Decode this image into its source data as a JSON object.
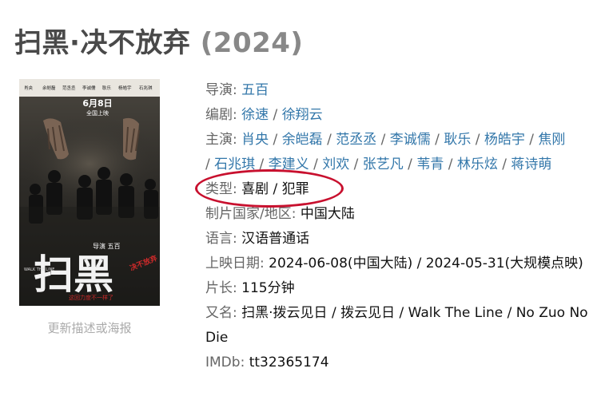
{
  "movie": {
    "title": "扫黑·决不放弃",
    "year": "(2024)"
  },
  "poster": {
    "credits": [
      "肖央",
      "余皑磊",
      "范丞丞",
      "李诚儒",
      "耿乐",
      "杨皓宇",
      "石兆琪"
    ],
    "date_line1": "6月8日",
    "date_line2": "全国上映",
    "director_line": "导演 五百",
    "title_chars": "扫黑",
    "sub_title": "决不放弃",
    "english": "WALK THE LINE",
    "tagline": "这回力度不一样了"
  },
  "update_link": "更新描述或海报",
  "info": {
    "director_label": "导演: ",
    "director": "五百",
    "writer_label": "编剧: ",
    "writers": [
      "徐速",
      "徐翔云"
    ],
    "cast_label": "主演: ",
    "cast": [
      "肖央",
      "余皑磊",
      "范丞丞",
      "李诚儒",
      "耿乐",
      "杨皓宇",
      "焦刚",
      "石兆琪",
      "李建义",
      "刘欢",
      "张艺凡",
      "苇青",
      "林乐炫",
      "蒋诗萌"
    ],
    "genre_label": "类型: ",
    "genres": [
      "喜剧",
      "犯罪"
    ],
    "country_label": "制片国家/地区: ",
    "country": "中国大陆",
    "language_label": "语言: ",
    "language": "汉语普通话",
    "release_label": "上映日期: ",
    "release": "2024-06-08(中国大陆) / 2024-05-31(大规模点映)",
    "runtime_label": "片长: ",
    "runtime": "115分钟",
    "aka_label": "又名: ",
    "aka": "扫黑·拨云见日 / 拨云见日 / Walk The Line / No Zuo No Die",
    "imdb_label": "IMDb: ",
    "imdb": "tt32365174"
  },
  "colors": {
    "link": "#3377aa",
    "label": "#666666",
    "highlight": "#c8102e",
    "title": "#494949",
    "year": "#888888"
  }
}
